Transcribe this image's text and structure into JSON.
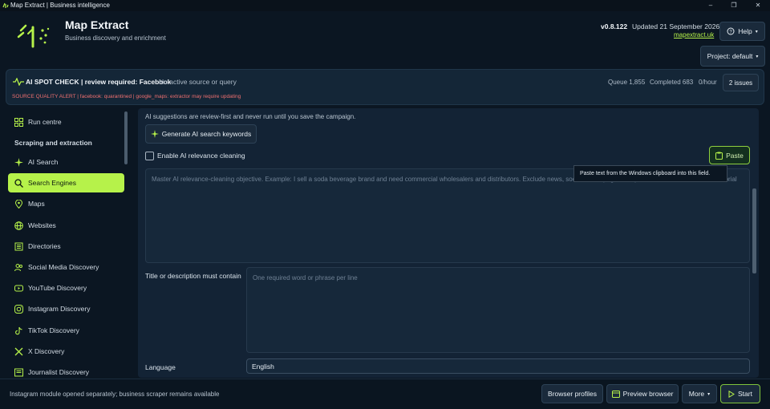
{
  "window": {
    "title": "Map Extract | Business intelligence"
  },
  "header": {
    "app_name": "Map Extract",
    "subtitle": "Business discovery and enrichment",
    "version": "v0.8.122",
    "updated": "Updated 21 September 2026",
    "site": "mapextract.uk",
    "help_label": "Help",
    "project_label": "Project: default"
  },
  "banner": {
    "title": "AI SPOT CHECK | review required: Facebook",
    "subtitle": "No active source or query",
    "alert": "SOURCE QUALITY ALERT | facebook: quarantined | google_maps: extractor may require updating",
    "queue": "Queue 1,855",
    "completed": "Completed 683",
    "rate": "0/hour",
    "issues_label": "2 issues"
  },
  "sidebar": {
    "section": "Scraping and extraction",
    "items": [
      {
        "label": "Run centre",
        "icon": "grid-icon"
      },
      {
        "label": "AI Search",
        "icon": "sparkle-icon"
      },
      {
        "label": "Search Engines",
        "icon": "search-icon"
      },
      {
        "label": "Maps",
        "icon": "pin-icon"
      },
      {
        "label": "Websites",
        "icon": "globe-icon"
      },
      {
        "label": "Directories",
        "icon": "directory-icon"
      },
      {
        "label": "Social Media Discovery",
        "icon": "people-icon"
      },
      {
        "label": "YouTube Discovery",
        "icon": "play-icon"
      },
      {
        "label": "Instagram Discovery",
        "icon": "instagram-icon"
      },
      {
        "label": "TikTok Discovery",
        "icon": "tiktok-icon"
      },
      {
        "label": "X Discovery",
        "icon": "x-icon"
      },
      {
        "label": "Journalist Discovery",
        "icon": "news-icon"
      }
    ]
  },
  "main": {
    "ai_note": "AI suggestions are review-first and never run until you save the campaign.",
    "generate_label": "Generate AI search keywords",
    "relevance_label": "Enable AI relevance cleaning",
    "paste_label": "Paste",
    "objective_placeholder": "Master AI relevance-cleaning objective. Example: I sell a soda beverage brand and need commercial wholesalers and distributors. Exclude news, social media pages, recipes, consumer reviews and editorial",
    "tooltip": "Paste text from the Windows clipboard into this field.",
    "title_label": "Title or description must contain",
    "title_placeholder": "One required word or phrase per line",
    "language_label": "Language",
    "language_value": "English"
  },
  "footer": {
    "status": "Instagram module opened separately; business scraper remains available",
    "profiles_label": "Browser profiles",
    "preview_label": "Preview browser",
    "more_label": "More",
    "start_label": "Start"
  },
  "colors": {
    "accent": "#b6f24a",
    "alert": "#f07070",
    "background": "#0b1622"
  }
}
